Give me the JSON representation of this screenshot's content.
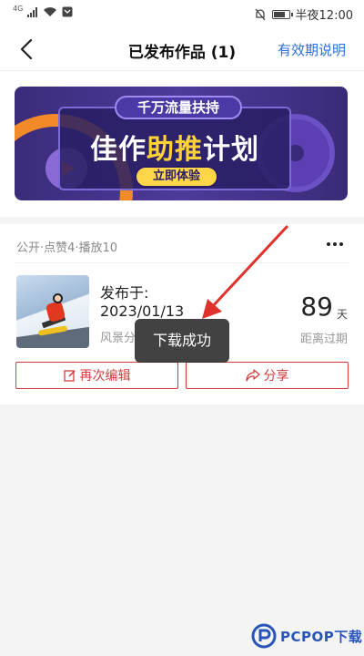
{
  "status_bar": {
    "network_label": "4G",
    "time_text": "半夜12:00"
  },
  "header": {
    "title": "已发布作品 (1)",
    "right_link": "有效期说明"
  },
  "banner": {
    "tag_text": "千万流量扶持",
    "headline_part1": "佳作",
    "headline_highlight": "助推",
    "headline_part2": "计划",
    "cta_text": "立即体验"
  },
  "work": {
    "meta": "公开·点赞4·播放10",
    "publish_label": "发布于:",
    "publish_date": "2023/01/13",
    "category": "风景分",
    "days_left": "89",
    "days_unit": "天",
    "expire_label": "距离过期",
    "edit_button": "再次编辑",
    "share_button": "分享"
  },
  "toast": {
    "text": "下载成功"
  },
  "watermark": {
    "text": "PCPOP下载"
  },
  "colors": {
    "accent_red": "#d23b3b",
    "link_blue": "#2c6fd6",
    "banner_purple": "#4e3a9a",
    "banner_yellow": "#ffd23a"
  }
}
